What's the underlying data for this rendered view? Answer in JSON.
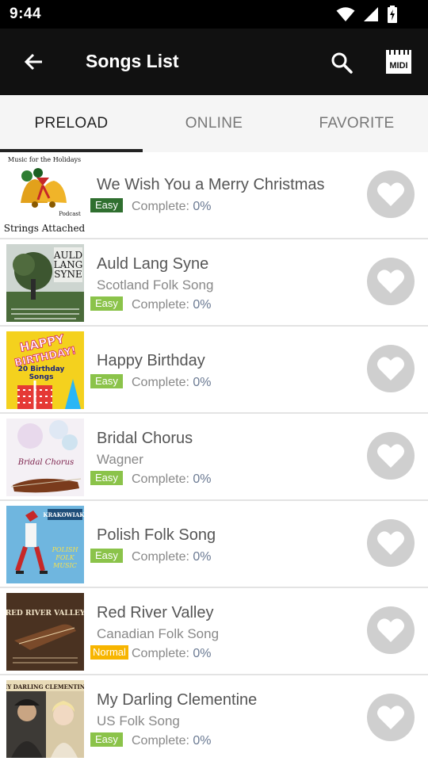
{
  "status_bar": {
    "time": "9:44"
  },
  "app_bar": {
    "title": "Songs List",
    "midi_label": "MIDI"
  },
  "tabs": [
    {
      "label": "PRELOAD",
      "active": true
    },
    {
      "label": "ONLINE",
      "active": false
    },
    {
      "label": "FAVORITE",
      "active": false
    }
  ],
  "complete_label": "Complete:",
  "songs": [
    {
      "title": "We Wish You a Merry Christmas",
      "subtitle": "",
      "difficulty": "Easy",
      "progress": "0%",
      "cover_text": {
        "top": "Music for the Holidays",
        "middle": "Podcast",
        "bottom": "Strings Attached"
      }
    },
    {
      "title": "Auld Lang Syne",
      "subtitle": "Scotland Folk Song",
      "difficulty": "Easy",
      "progress": "0%",
      "cover_text": {
        "line1": "AULD",
        "line2": "LANG",
        "line3": "SYNE"
      }
    },
    {
      "title": "Happy Birthday",
      "subtitle": "",
      "difficulty": "Easy",
      "progress": "0%",
      "cover_text": {
        "line1": "HAPPY",
        "line2": "BIRTHDAY!",
        "line3": "20 Birthday",
        "line4": "Songs"
      }
    },
    {
      "title": "Bridal Chorus",
      "subtitle": "Wagner",
      "difficulty": "Easy",
      "progress": "0%",
      "cover_text": {
        "line1": "Bridal Chorus"
      }
    },
    {
      "title": "Polish Folk Song",
      "subtitle": "",
      "difficulty": "Easy",
      "progress": "0%",
      "cover_text": {
        "line1": "KRAKOWIAKI",
        "line2": "POLISH",
        "line3": "FOLK",
        "line4": "MUSIC"
      }
    },
    {
      "title": "Red River Valley",
      "subtitle": "Canadian Folk Song",
      "difficulty": "Normal",
      "progress": "0%",
      "cover_text": {
        "line1": "RED RIVER VALLEY"
      }
    },
    {
      "title": "My Darling Clementine",
      "subtitle": "US Folk Song",
      "difficulty": "Easy",
      "progress": "0%",
      "cover_text": {
        "line1": "MY DARLING CLEMENTINE"
      }
    }
  ],
  "colors": {
    "status_bar": "#000000",
    "app_bar": "#111111",
    "tab_bar": "#f5f5f5",
    "easy_badge": "#8bc34a",
    "easy_badge_dark": "#2f6f2f",
    "normal_badge": "#f7b500",
    "favorite_button": "#cfcfcf"
  },
  "icons": [
    "back-arrow-icon",
    "search-icon",
    "midi-icon",
    "wifi-icon",
    "signal-icon",
    "battery-icon",
    "heart-icon"
  ]
}
